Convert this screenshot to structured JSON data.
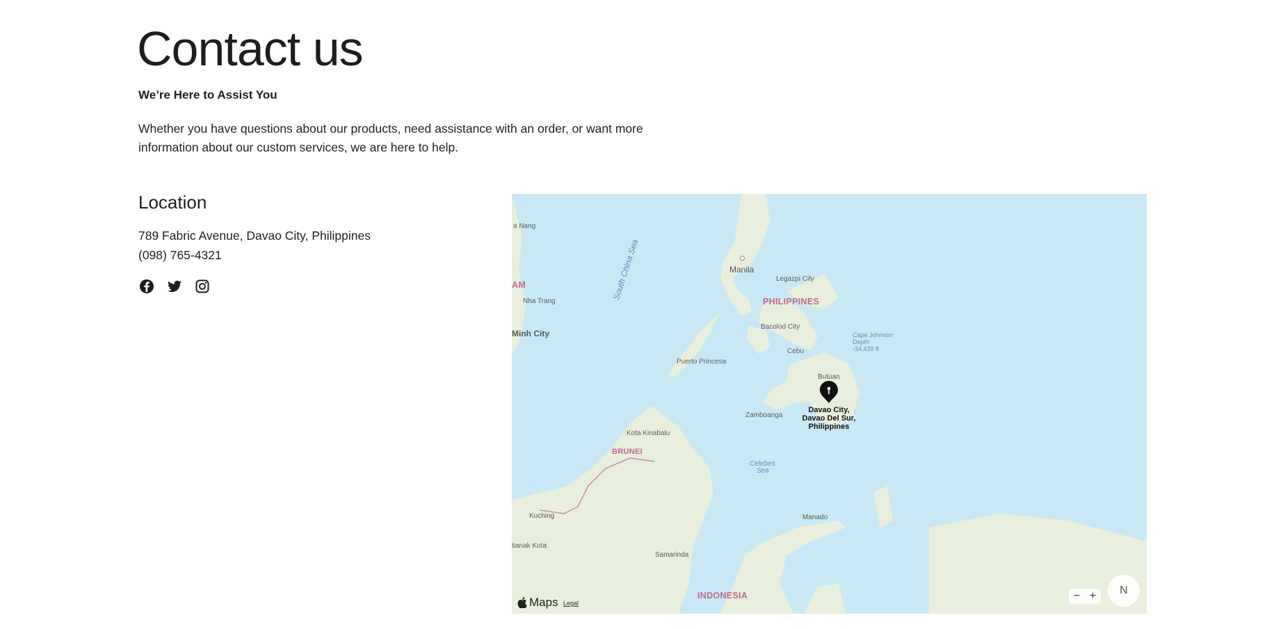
{
  "header": {
    "title": "Contact us",
    "subtitle": "We’re Here to Assist You",
    "intro": "Whether you have questions about our products, need assistance with an order, or want more information about our custom services, we are here to help."
  },
  "location": {
    "heading": "Location",
    "address": "789 Fabric Avenue, Davao City, Philippines",
    "phone": "(098) 765-4321",
    "social": [
      "facebook-icon",
      "twitter-icon",
      "instagram-icon"
    ]
  },
  "map": {
    "pin_label": "Davao City, Davao Del Sur, Philippines",
    "brand": "Maps",
    "legal": "Legal",
    "zoom_out": "−",
    "zoom_in": "+",
    "compass": "N",
    "labels": {
      "da_nang": "a Nang",
      "south_china_sea": "South China Sea",
      "manila": "Manila",
      "am": "AM",
      "legazpi": "Legazpi City",
      "philippines": "PHILIPPINES",
      "nha_trang": "Nha Trang",
      "hcm": "Minh City",
      "bacolod": "Bacolod City",
      "cape_johnson": "Cape Johnson",
      "depth": "Depth",
      "depth_value": "-34,439 ft",
      "cebu": "Cebu",
      "puerto_princesa": "Puerto Princesa",
      "butuan": "Butuan",
      "zamboanga": "Zamboanga",
      "kota_kinabalu": "Kota Kinabalu",
      "brunei": "BRUNEI",
      "celebes": "Celebes",
      "sea": "Sea",
      "kuching": "Kuching",
      "manado": "Manado",
      "pontianak": "tianak Kota",
      "samarinda": "Samarinda",
      "indonesia": "INDONESIA"
    }
  },
  "colors": {
    "water": "#c9e8f6",
    "land": "#e8efdc",
    "country_label": "#c06b8e",
    "text": "#1e1e1e"
  }
}
